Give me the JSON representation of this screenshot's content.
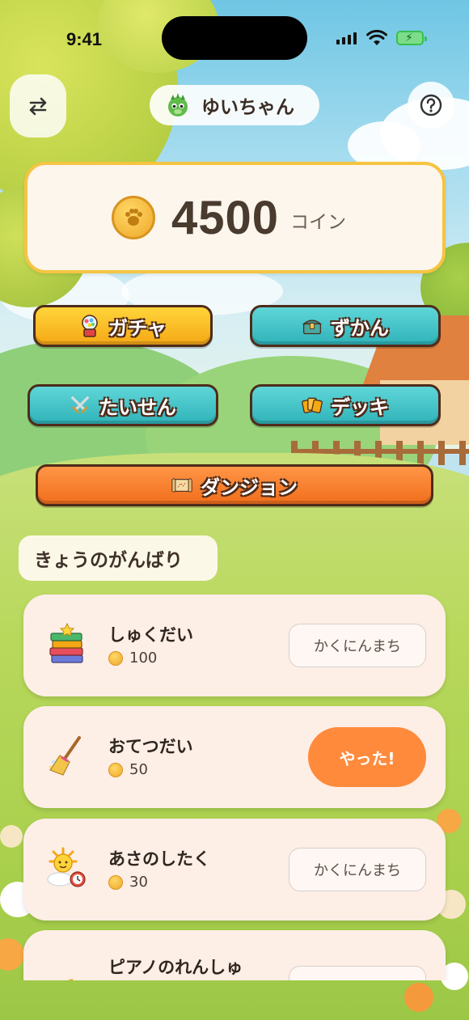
{
  "status_bar": {
    "time": "9:41"
  },
  "header": {
    "profile_name": "ゆいちゃん",
    "swap_icon": "swap-arrows-icon",
    "help_icon": "question-circle-icon",
    "avatar_icon": "green-dragon-avatar-icon"
  },
  "balance": {
    "amount": "4500",
    "unit": "コイン",
    "icon": "paw-coin-icon"
  },
  "menu": {
    "gacha": "ガチャ",
    "zukan": "ずかん",
    "taisen": "たいせん",
    "deck": "デッキ",
    "dungeon": "ダンジョン"
  },
  "section": {
    "title": "きょうのがんばり"
  },
  "tasks": [
    {
      "title": "しゅくだい",
      "reward": "100",
      "action": "かくにんまち",
      "state": "pending",
      "icon": "book-stack-icon"
    },
    {
      "title": "おてつだい",
      "reward": "50",
      "action": "やった!",
      "state": "todo",
      "icon": "broom-icon"
    },
    {
      "title": "あさのしたく",
      "reward": "30",
      "action": "かくにんまち",
      "state": "pending",
      "icon": "sun-alarm-clock-icon"
    },
    {
      "title": "ピアノのれんしゅ",
      "reward": "",
      "action": "",
      "state": "pending",
      "icon": "music-note-icon"
    }
  ],
  "colors": {
    "coin_border": "#f5c442",
    "gacha": "#f5a816",
    "teal": "#2fb3b9",
    "dungeon": "#f06e1c",
    "done_button": "#ff8a3c",
    "card": "#fdeee6"
  }
}
